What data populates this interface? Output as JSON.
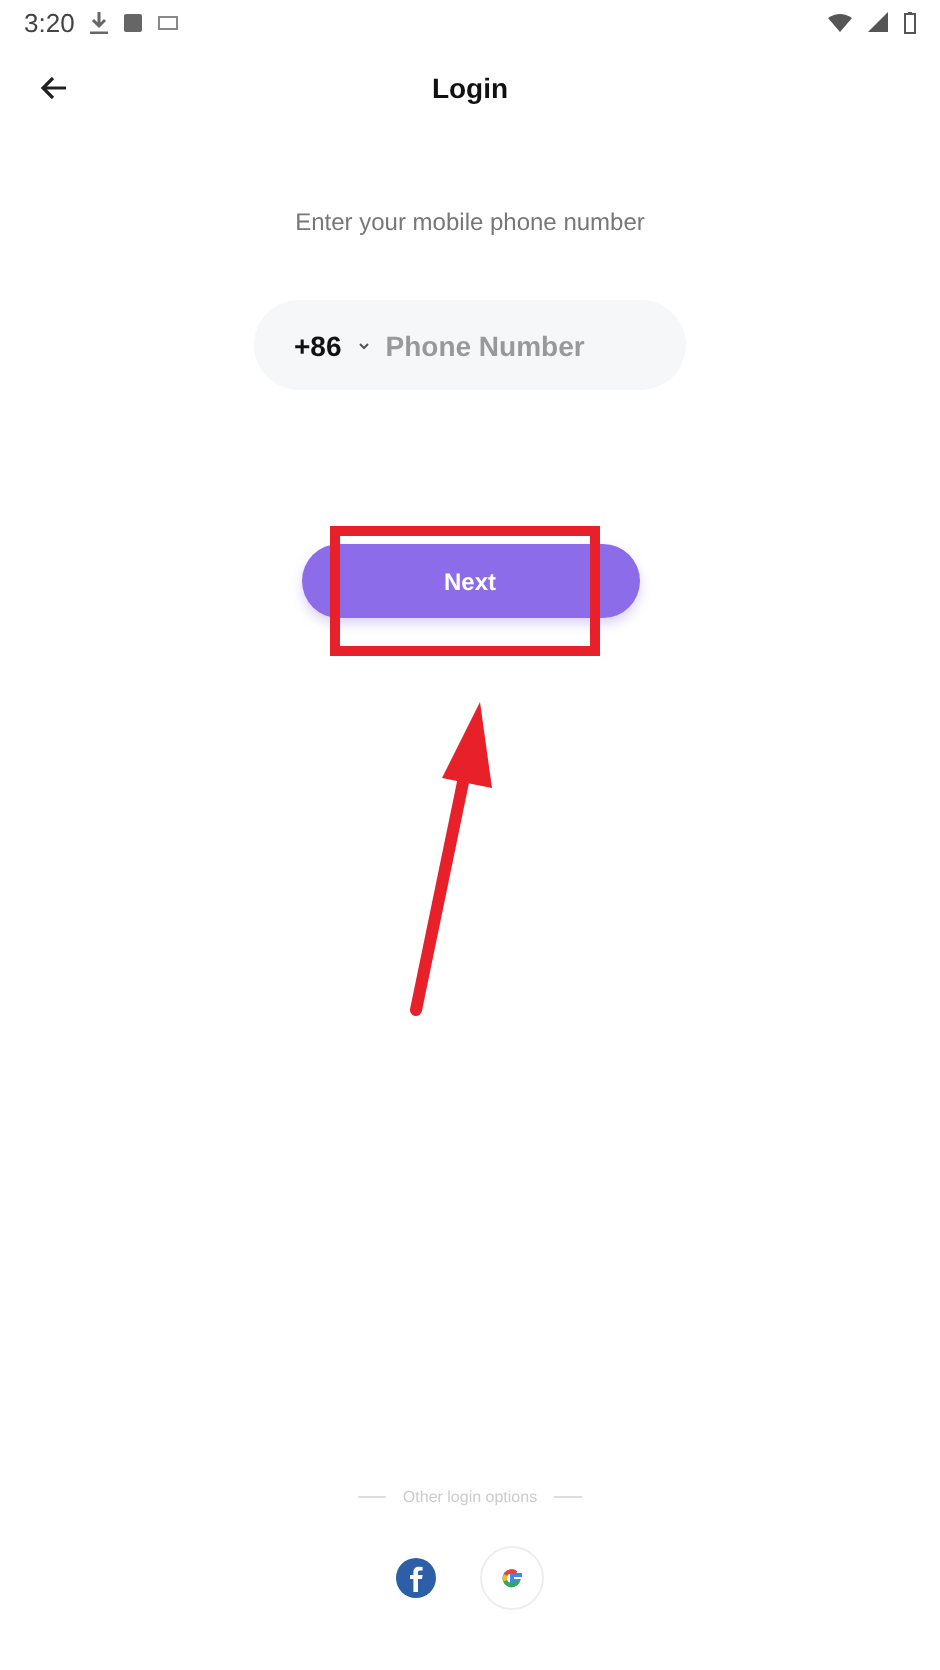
{
  "status_bar": {
    "time": "3:20"
  },
  "header": {
    "title": "Login"
  },
  "prompt": "Enter your mobile phone number",
  "phone_field": {
    "country_code": "+86",
    "placeholder": "Phone Number"
  },
  "next_button": {
    "label": "Next"
  },
  "other_login": {
    "label": "Other login options"
  }
}
